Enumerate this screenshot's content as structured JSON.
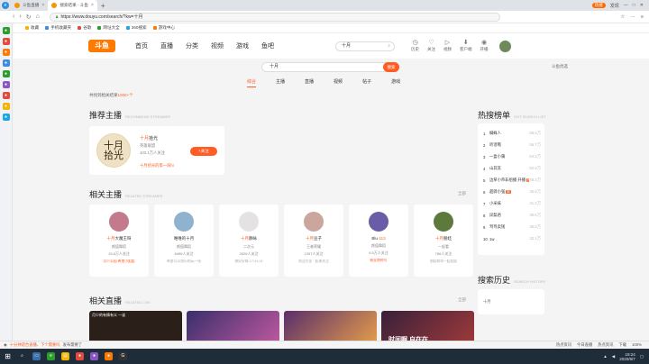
{
  "browser": {
    "tabs": [
      {
        "title": "斗鱼直播"
      },
      {
        "title": "搜索结果 - 斗鱼",
        "active": true
      }
    ],
    "url": "https://www.douyu.com/search/?kw=十月",
    "bookmarks": [
      "收藏",
      "手机收藏夹",
      "谷歌",
      "网址大全",
      "360搜索",
      "游戏中心"
    ],
    "right": {
      "discover": "发现",
      "pill": "热搜"
    }
  },
  "site": {
    "logo": "斗鱼",
    "nav": [
      "首页",
      "直播",
      "分类",
      "视频",
      "游戏",
      "鱼吧"
    ],
    "header_search": "十月",
    "header_icons": [
      {
        "icon": "history-icon",
        "label": "历史"
      },
      {
        "icon": "follow-icon",
        "label": "关注"
      },
      {
        "icon": "video-icon",
        "label": "视频"
      },
      {
        "icon": "download-icon",
        "label": "客户端"
      },
      {
        "icon": "start-live-icon",
        "label": "开播"
      }
    ]
  },
  "search": {
    "query": "十月",
    "button": "搜索",
    "fallback": "斗鱼优选",
    "tabs": [
      "综合",
      "主播",
      "直播",
      "视频",
      "帖子",
      "游戏"
    ],
    "active_tab": "综合",
    "result_prefix": "共找到相关结果",
    "result_count": "1000+个"
  },
  "sections": {
    "recommended": {
      "title": "推荐主播",
      "subtitle": "RECOMMEND STREAMER"
    },
    "related_anchors": {
      "title": "相关主播",
      "subtitle": "RELATED STREAMER",
      "more": "全部"
    },
    "related_live": {
      "title": "相关直播",
      "subtitle": "RELATED LIVE",
      "more": "全部"
    },
    "hot": {
      "title": "热搜榜单",
      "subtitle": "HOT SEARCH LIST"
    },
    "history": {
      "title": "搜索历史",
      "subtitle": "SEARCH HISTORY",
      "items": [
        "十月"
      ]
    }
  },
  "recommended_anchor": {
    "avatar_text": "十月 拾光",
    "name_hl": "十月",
    "name_rest": "拾光",
    "category": "英雄联盟",
    "fans": "103.1万人关注",
    "live": "十月拾光的第一局hi",
    "follow": "+关注"
  },
  "hot_list": [
    {
      "rank": "1",
      "kw": "蜘蛛人",
      "val": "58.6万"
    },
    {
      "rank": "2",
      "kw": "听话哦",
      "val": "56.7万"
    },
    {
      "rank": "3",
      "kw": "一盒小蒲",
      "val": "54.2万"
    },
    {
      "rank": "4",
      "kw": "山其其",
      "val": "52.5万"
    },
    {
      "rank": "5",
      "kw": "边草小帝非组播 开播",
      "val": "48.3万",
      "tag": "热"
    },
    {
      "rank": "6",
      "kw": "超骑小强",
      "val": "45.6万",
      "tag": "新"
    },
    {
      "rank": "7",
      "kw": "小米妹",
      "val": "41.2万"
    },
    {
      "rank": "8",
      "kw": "凤梨君",
      "val": "39.6万"
    },
    {
      "rank": "9",
      "kw": "骂骂卖钱",
      "val": "36.2万"
    },
    {
      "rank": "10",
      "kw": "1w",
      "val": "32.1万"
    }
  ],
  "related_anchors": [
    {
      "pre": "十月",
      "name": "大魔王呀",
      "cat": "颜值舞蹈",
      "fans": "15.8万人关注",
      "desc": "月少公园 希望小姐姐",
      "live": true,
      "color": "#c47a8d"
    },
    {
      "pre": "",
      "name": "唯唯的十月",
      "cat": "颜值舞蹈",
      "fans": "6496人关注",
      "desc": "希望可以快乐的玩一场",
      "live": false,
      "color": "#8fb3cf"
    },
    {
      "pre": "十月",
      "name": "静咏",
      "cat": "二次元",
      "fans": "2626人关注",
      "desc": "想好好睡 17:41:14",
      "live": false,
      "color": "#e4e2e3"
    },
    {
      "pre": "十月",
      "name": "豆子",
      "cat": "王者荣耀",
      "fans": "1397人关注",
      "desc": "欢迎大家 · 起来关注",
      "live": false,
      "color": "#caa69c"
    },
    {
      "pre": "Blu·",
      "name": "113",
      "cat": "颜值舞蹈",
      "fans": "6.5万人关注",
      "desc": "粉丝牌称号",
      "live": true,
      "color": "#6b5ca8"
    },
    {
      "pre": "十月",
      "name": "朋娃",
      "cat": "一起看",
      "fans": "786人关注",
      "desc": "朋娃和你一起娃娃",
      "live": false,
      "color": "#5d7a3c"
    }
  ],
  "related_live": [
    {
      "caption": "月少的有情有义 一谈",
      "mark": "",
      "color": "#2b1f1a"
    },
    {
      "caption": "",
      "mark": "",
      "color": "#3a2f6c"
    },
    {
      "caption": "",
      "mark": "",
      "color": "#5a2e6b"
    },
    {
      "caption": "",
      "mark": "",
      "color": "#6c4a3e"
    },
    {
      "caption": "",
      "mark": "时间啊 自在在",
      "color": "#38203a"
    }
  ],
  "statusbar": {
    "text_hl": "十分钟适合直播、下个需要吗",
    "text": "发布需要了",
    "right": [
      "热点资讯",
      "今日直播",
      "热点资讯",
      "下载",
      "100%"
    ]
  },
  "taskbar": {
    "time": "19:24",
    "date": "2020/9/7"
  }
}
